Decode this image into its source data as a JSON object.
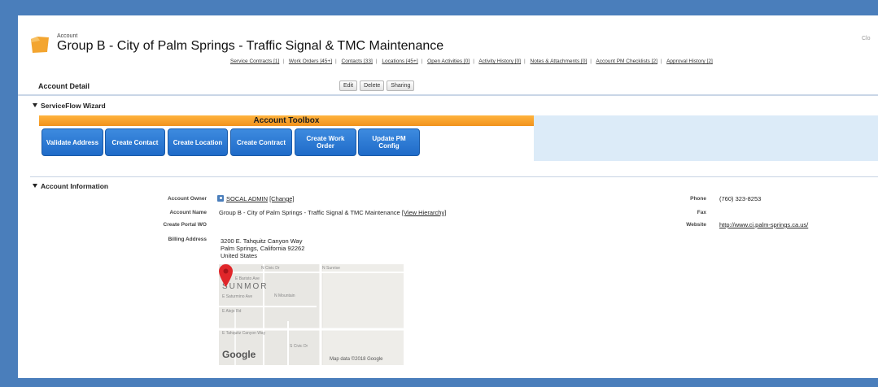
{
  "header": {
    "eyebrow": "Account",
    "title": "Group B - City of Palm Springs - Traffic Signal & TMC Maintenance",
    "corner_text": "Clo"
  },
  "related_links": [
    "Service Contracts [1]",
    "Work Orders [45+]",
    "Contacts [33]",
    "Locations [45+]",
    "Open Activities [0]",
    "Activity History [0]",
    "Notes & Attachments [0]",
    "Account PM Checklists [2]",
    "Approval History [2]"
  ],
  "detail": {
    "title": "Account Detail",
    "edit": "Edit",
    "delete": "Delete",
    "sharing": "Sharing"
  },
  "wizard": {
    "section_title": "ServiceFlow Wizard",
    "toolbox_title": "Account Toolbox",
    "buttons": {
      "validate_address": "Validate Address",
      "create_contact": "Create Contact",
      "create_location": "Create Location",
      "create_contract": "Create Contract",
      "create_work_order": "Create Work Order",
      "update_pm_config": "Update PM Config"
    }
  },
  "info": {
    "section_title": "Account Information",
    "owner_label": "Account Owner",
    "owner_value": "SOCAL ADMIN",
    "owner_change": "[Change]",
    "name_label": "Account Name",
    "name_value": "Group B - City of Palm Springs - Traffic Signal & TMC Maintenance",
    "name_hierarchy": "[View Hierarchy]",
    "portal_label": "Create Portal WO",
    "billing_label": "Billing Address",
    "billing_line1": "3200 E. Tahquitz Canyon Way",
    "billing_line2": "Palm Springs, California 92262",
    "billing_line3": "United States",
    "phone_label": "Phone",
    "phone_value": "(760) 323-8253",
    "fax_label": "Fax",
    "website_label": "Website",
    "website_value": "http://www.ci.palm-springs.ca.us/"
  },
  "map": {
    "neighborhood": "SUNMOR",
    "attribution": "Map data ©2018 Google",
    "logo": "Google",
    "streets": {
      "n_civic": "N Civic Dr",
      "e_baristo": "E Baristo Ave",
      "e_jacinto": "E Saturmino Ave",
      "e_alejo": "E Alejo Rd",
      "e_tahquitz": "E Tahquitz Canyon Way",
      "s_civic": "S Civic Dr",
      "n_sunrise": "N Sunrise",
      "n_mountain": "N Mountain"
    }
  },
  "colors": {
    "frame_bg": "#4a7ebb",
    "toolbox_orange": "#f1921c",
    "button_blue": "#1f6bc8",
    "toolbox_panel": "#dcebf8",
    "map_pin": "#e0262a"
  }
}
